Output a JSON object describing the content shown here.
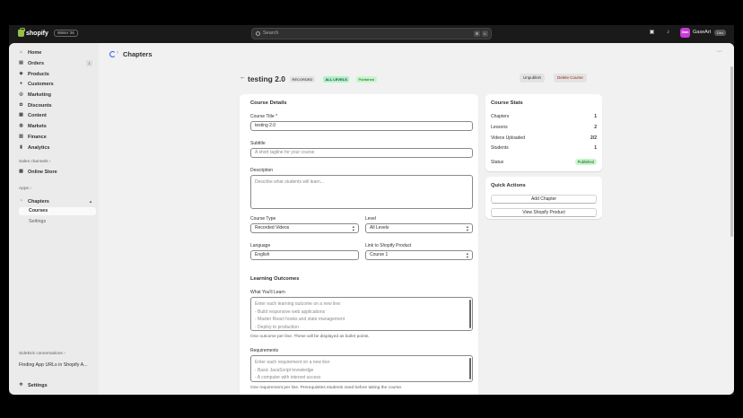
{
  "topbar": {
    "logo_text": "shopify",
    "edition_badge": "Winter '26",
    "search_placeholder": "Search",
    "shortcut_keys": [
      "⌘",
      "K"
    ],
    "store_avatar": "Gam",
    "store_name": "GaseArt",
    "dev_badge": "Dev"
  },
  "sidebar": {
    "nav": [
      {
        "label": "Home",
        "icon": "home-icon"
      },
      {
        "label": "Orders",
        "icon": "orders-icon",
        "count": "1"
      },
      {
        "label": "Products",
        "icon": "tag-icon"
      },
      {
        "label": "Customers",
        "icon": "person-icon"
      },
      {
        "label": "Marketing",
        "icon": "target-icon"
      },
      {
        "label": "Discounts",
        "icon": "discount-icon"
      },
      {
        "label": "Content",
        "icon": "content-icon"
      },
      {
        "label": "Markets",
        "icon": "globe-icon"
      },
      {
        "label": "Finance",
        "icon": "bank-icon"
      },
      {
        "label": "Analytics",
        "icon": "chart-icon"
      }
    ],
    "sales_channels_label": "Sales channels",
    "online_store_label": "Online Store",
    "apps_label": "Apps",
    "app_name": "Chapters",
    "app_sub": [
      "Courses",
      "Settings"
    ],
    "sidekick_label": "Sidekick conversations",
    "sidekick_item": "Finding App URLs in Shopify A...",
    "settings_label": "Settings"
  },
  "app_header": {
    "title": "Chapters"
  },
  "page": {
    "title": "testing 2.0",
    "badge_type": "RECORDED",
    "badge_level": "ALL LEVELS",
    "badge_status": "Published",
    "unpublish_label": "Unpublish",
    "delete_label": "Delete Course"
  },
  "course_details": {
    "card_title": "Course Details",
    "title_label": "Course Title *",
    "title_value": "testing 2.0",
    "subtitle_label": "Subtitle",
    "subtitle_placeholder": "A short tagline for your course",
    "description_label": "Description",
    "description_placeholder": "Describe what students will learn...",
    "type_label": "Course Type",
    "type_value": "Recorded Videos",
    "level_label": "Level",
    "level_value": "All Levels",
    "language_label": "Language",
    "language_value": "English",
    "link_label": "Link to Shopify Product",
    "link_value": "Course 1"
  },
  "learning_outcomes": {
    "section_title": "Learning Outcomes",
    "learn_label": "What You'll Learn",
    "learn_lines": [
      "Enter each learning outcome on a new line:",
      "- Build responsive web applications",
      "- Master React hooks and state management",
      "- Deploy to production"
    ],
    "learn_help": "One outcome per line. These will be displayed as bullet points.",
    "req_label": "Requirements",
    "req_lines": [
      "Enter each requirement on a new line:",
      "- Basic JavaScript knowledge",
      "- A computer with internet access"
    ],
    "req_help": "One requirement per line. Prerequisites students need before taking the course."
  },
  "course_stats": {
    "card_title": "Course Stats",
    "rows": [
      {
        "label": "Chapters",
        "value": "1"
      },
      {
        "label": "Lessons",
        "value": "2"
      },
      {
        "label": "Videos Uploaded",
        "value": "2/2"
      },
      {
        "label": "Students",
        "value": "1"
      }
    ],
    "status_label": "Status",
    "status_value": "Published"
  },
  "quick_actions": {
    "card_title": "Quick Actions",
    "add_chapter": "Add Chapter",
    "view_product": "View Shopify Product"
  }
}
